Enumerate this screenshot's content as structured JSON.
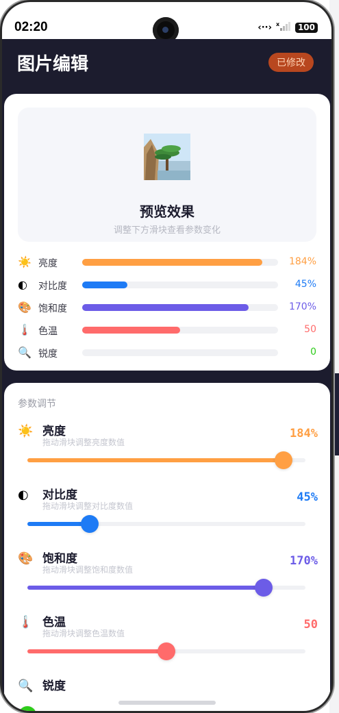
{
  "status": {
    "time": "02:20",
    "battery": "100"
  },
  "header": {
    "title": "图片编辑",
    "badge": "已修改"
  },
  "preview": {
    "title": "预览效果",
    "subtitle": "调整下方滑块查看参数变化"
  },
  "summary": [
    {
      "icon": "sun-icon",
      "glyph": "☀️",
      "label": "亮度",
      "value_text": "184%",
      "fraction": 0.92,
      "color": "#ff9f43"
    },
    {
      "icon": "contrast-icon",
      "glyph": "◐",
      "label": "对比度",
      "value_text": "45%",
      "fraction": 0.23,
      "color": "#1e7bf5"
    },
    {
      "icon": "palette-icon",
      "glyph": "🎨",
      "label": "饱和度",
      "value_text": "170%",
      "fraction": 0.85,
      "color": "#6c5ce7"
    },
    {
      "icon": "thermometer-icon",
      "glyph": "🌡️",
      "label": "色温",
      "value_text": "50",
      "fraction": 0.5,
      "color": "#ff6b6b"
    },
    {
      "icon": "magnifier-icon",
      "glyph": "🔍",
      "label": "锐度",
      "value_text": "0",
      "fraction": 0,
      "color": "#2ecc1a"
    }
  ],
  "controls": {
    "section_title": "参数调节",
    "items": [
      {
        "icon": "sun-icon",
        "glyph": "☀️",
        "label": "亮度",
        "hint": "拖动滑块调整亮度数值",
        "value_text": "184%",
        "fraction": 0.92,
        "color": "#ff9f43"
      },
      {
        "icon": "contrast-icon",
        "glyph": "◐",
        "label": "对比度",
        "hint": "拖动滑块调整对比度数值",
        "value_text": "45%",
        "fraction": 0.225,
        "color": "#1e7bf5"
      },
      {
        "icon": "palette-icon",
        "glyph": "🎨",
        "label": "饱和度",
        "hint": "拖动滑块调整饱和度数值",
        "value_text": "170%",
        "fraction": 0.85,
        "color": "#6c5ce7"
      },
      {
        "icon": "thermometer-icon",
        "glyph": "🌡️",
        "label": "色温",
        "hint": "拖动滑块调整色温数值",
        "value_text": "50",
        "fraction": 0.5,
        "color": "#ff6b6b"
      },
      {
        "icon": "magnifier-icon",
        "glyph": "🔍",
        "label": "锐度",
        "hint": "",
        "value_text": "",
        "fraction": 0,
        "color": "#2ecc1a"
      }
    ]
  }
}
